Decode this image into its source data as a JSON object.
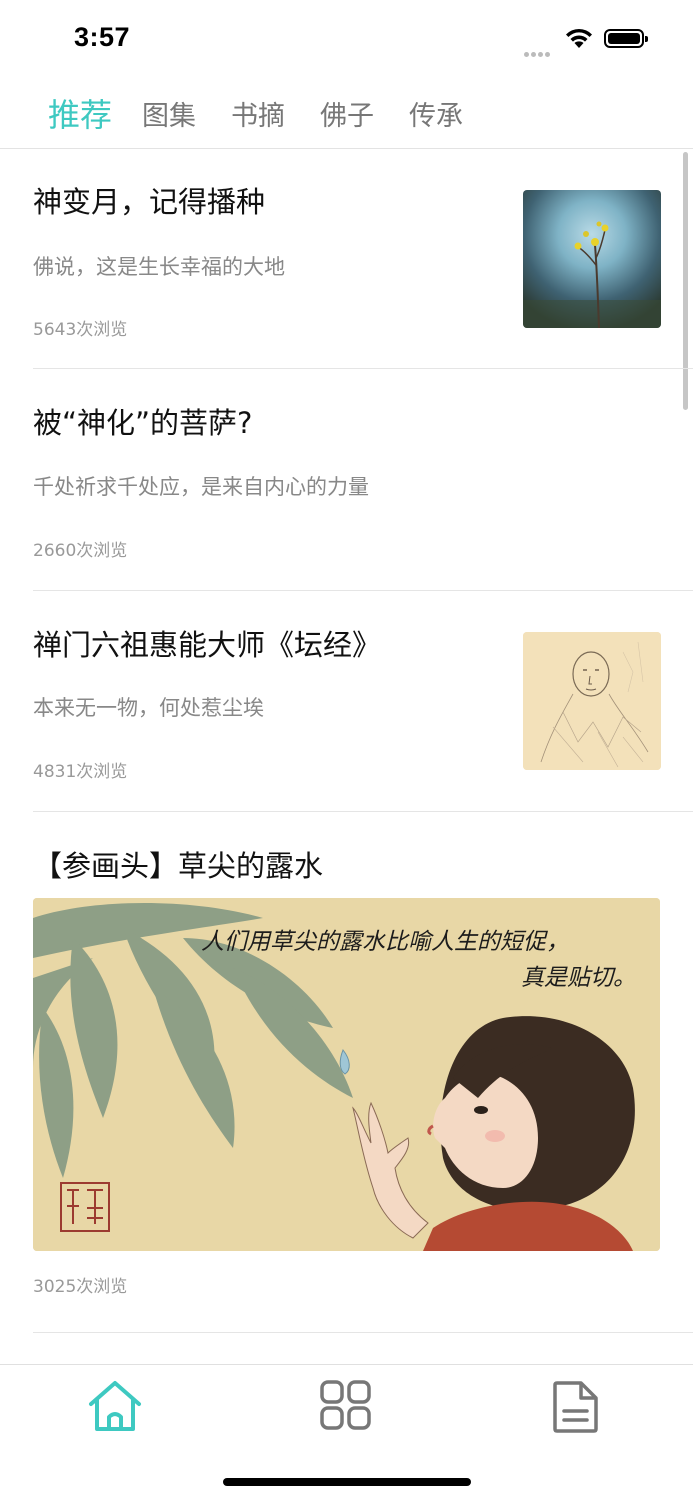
{
  "status_bar": {
    "time": "3:57"
  },
  "tabs": [
    {
      "label": "推荐",
      "active": true
    },
    {
      "label": "图集",
      "active": false
    },
    {
      "label": "书摘",
      "active": false
    },
    {
      "label": "佛子",
      "active": false
    },
    {
      "label": "传承",
      "active": false
    }
  ],
  "articles": [
    {
      "title": "神变月，记得播种",
      "subtitle": "佛说，这是生长幸福的大地",
      "views": "5643次浏览"
    },
    {
      "title": "被“神化”的菩萨?",
      "subtitle": "千处祈求千处应，是来自内心的力量",
      "views": "2660次浏览"
    },
    {
      "title": "禅门六祖惠能大师《坛经》",
      "subtitle": "本来无一物，何处惹尘埃",
      "views": "4831次浏览"
    },
    {
      "title": "【参画头】草尖的露水",
      "views": "3025次浏览",
      "image_caption_line1": "人们用草尖的露水比喻人生的短促，",
      "image_caption_line2": "真是贴切。"
    }
  ],
  "bottom_nav": [
    {
      "icon": "home-icon",
      "active": true
    },
    {
      "icon": "grid-icon",
      "active": false
    },
    {
      "icon": "document-icon",
      "active": false
    }
  ],
  "colors": {
    "accent": "#3ec9c1",
    "inactive": "#777777"
  }
}
